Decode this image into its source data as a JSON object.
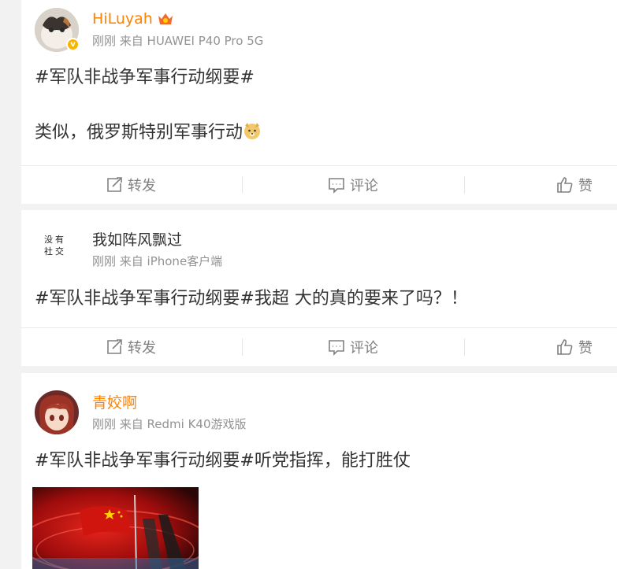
{
  "actions": {
    "repost": "转发",
    "comment": "评论",
    "like": "赞"
  },
  "posts": [
    {
      "username": "HiLuyah",
      "meta": "刚刚 来自 HUAWEI P40 Pro 5G",
      "line1": "#军队非战争军事行动纲要#",
      "line2": "类似，俄罗斯特别军事行动"
    },
    {
      "username": "我如阵风飘过",
      "avatar_text": "没有社交",
      "meta": "刚刚 来自 iPhone客户端",
      "line1": "#军队非战争军事行动纲要#我超 大的真的要来了吗？！"
    },
    {
      "username": "青姣啊",
      "meta": "刚刚 来自 Redmi K40游戏版",
      "line1": "#军队非战争军事行动纲要#听党指挥，能打胜仗"
    }
  ],
  "colors": {
    "accent": "#ff8200",
    "meta": "#939393",
    "action": "#808080",
    "verified": "#f7b500"
  },
  "icons": [
    "verified-badge-icon",
    "vip-crown-icon",
    "doge-emoji-icon",
    "repost-icon",
    "comment-icon",
    "like-icon"
  ]
}
